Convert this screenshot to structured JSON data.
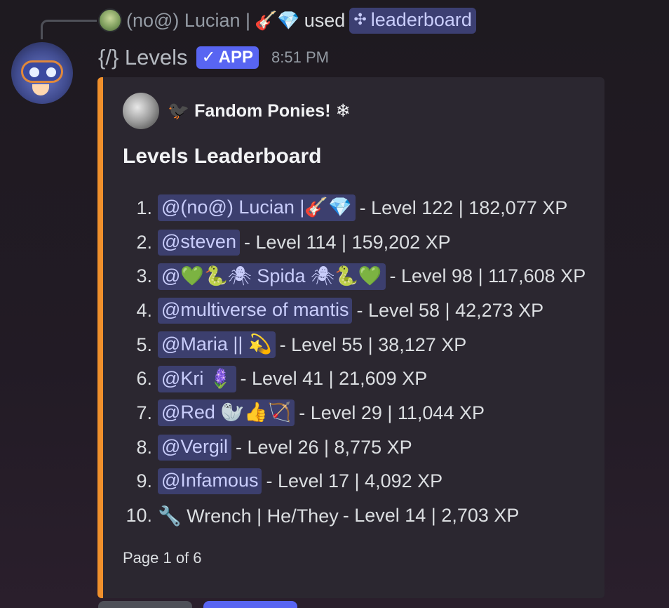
{
  "reply": {
    "user_name": "(no@) Lucian |",
    "user_emoji": "🎸💎",
    "used_text": "used",
    "command_icon": "✣",
    "command_name": "leaderboard"
  },
  "message": {
    "bot_name": "{/} Levels",
    "badge_check": "✓",
    "badge_label": "APP",
    "timestamp": "8:51 PM"
  },
  "embed": {
    "accent_color": "#f0902c",
    "author_name": "🐦‍⬛ Fandom Ponies! ❄",
    "title": "Levels Leaderboard",
    "footer": "Page 1 of 6",
    "entries": [
      {
        "rank": "1.",
        "name": "@(no@) Lucian |🎸💎",
        "mention": true,
        "stats": "- Level 122 | 182,077 XP"
      },
      {
        "rank": "2.",
        "name": "@steven",
        "mention": true,
        "stats": "- Level 114 | 159,202 XP"
      },
      {
        "rank": "3.",
        "name": "@💚🐍🕷 Spida 🕷🐍💚",
        "mention": true,
        "stats": "- Level 98 | 117,608 XP"
      },
      {
        "rank": "4.",
        "name": "@multiverse of mantis",
        "mention": true,
        "stats": "- Level 58 | 42,273 XP"
      },
      {
        "rank": "5.",
        "name": "@Maria || 💫",
        "mention": true,
        "stats": "- Level 55 | 38,127 XP"
      },
      {
        "rank": "6.",
        "name": "@Kri 🪻",
        "mention": true,
        "stats": "- Level 41 | 21,609 XP"
      },
      {
        "rank": "7.",
        "name": "@Red 🦭👍🏹",
        "mention": true,
        "stats": "- Level 29 | 11,044 XP"
      },
      {
        "rank": "8.",
        "name": "@Vergil",
        "mention": true,
        "stats": "- Level 26 | 8,775 XP"
      },
      {
        "rank": "9.",
        "name": "@Infamous",
        "mention": true,
        "stats": "- Level 17 | 4,092 XP"
      },
      {
        "rank": "10.",
        "name": "🔧 Wrench | He/They",
        "mention": false,
        "stats": "- Level 14 | 2,703 XP"
      }
    ]
  },
  "colors": {
    "mention_bg": "#3c3f6e",
    "mention_text": "#c9cdfb",
    "app_badge": "#5865f2"
  }
}
